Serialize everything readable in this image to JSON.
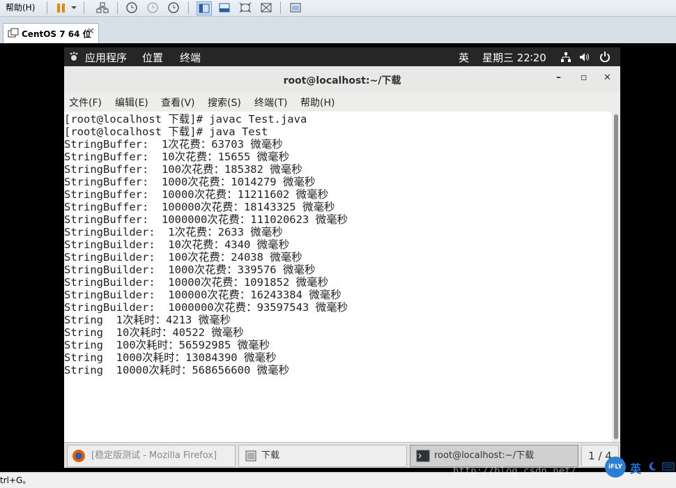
{
  "host": {
    "help_menu": "帮助(H)",
    "vm_tab_label": "CentOS 7 64 位"
  },
  "gnome_topbar": {
    "applications": "应用程序",
    "places": "位置",
    "terminal": "终端",
    "input_method": "英",
    "clock": "星期三 22∶20"
  },
  "window": {
    "title": "root@localhost:~/下载",
    "minimize": "–",
    "maximize": "▫",
    "close": "✕"
  },
  "menu": [
    "文件(F)",
    "编辑(E)",
    "查看(V)",
    "搜索(S)",
    "终端(T)",
    "帮助(H)"
  ],
  "terminal_lines": [
    "[root@localhost 下载]# javac Test.java",
    "[root@localhost 下载]# java Test",
    "StringBuffer:  1次花费：63703 微毫秒",
    "StringBuffer:  10次花费：15655 微毫秒",
    "StringBuffer:  100次花费：185382 微毫秒",
    "StringBuffer:  1000次花费：1014279 微毫秒",
    "StringBuffer:  10000次花费：11211602 微毫秒",
    "StringBuffer:  100000次花费：18143325 微毫秒",
    "StringBuffer:  1000000次花费：111020623 微毫秒",
    "StringBuilder:  1次花费：2633 微毫秒",
    "StringBuilder:  10次花费：4340 微毫秒",
    "StringBuilder:  100次花费：24038 微毫秒",
    "StringBuilder:  1000次花费：339576 微毫秒",
    "StringBuilder:  10000次花费：1091852 微毫秒",
    "StringBuilder:  100000次花费：16243384 微毫秒",
    "StringBuilder:  1000000次花费：93597543 微毫秒",
    "String  1次耗时：4213 微毫秒",
    "String  10次耗时：40522 微毫秒",
    "String  100次耗时：56592985 微毫秒",
    "String  1000次耗时：13084390 微毫秒",
    "String  10000次耗时：568656600 微毫秒"
  ],
  "taskbar": {
    "firefox": "[稳定版测试 - Mozilla Firefox]",
    "files": "下载",
    "terminal": "root@localhost:~/下载",
    "workspace": "1 / 4"
  },
  "status_text": "trl+G。",
  "watermark": "http://blog.csdn.net/",
  "ifly": {
    "logo": "iFLY",
    "lang": "英"
  },
  "colors": {
    "terminal_bg": "#ffffff",
    "terminal_fg": "#222222",
    "topbar_bg": "#262626"
  }
}
